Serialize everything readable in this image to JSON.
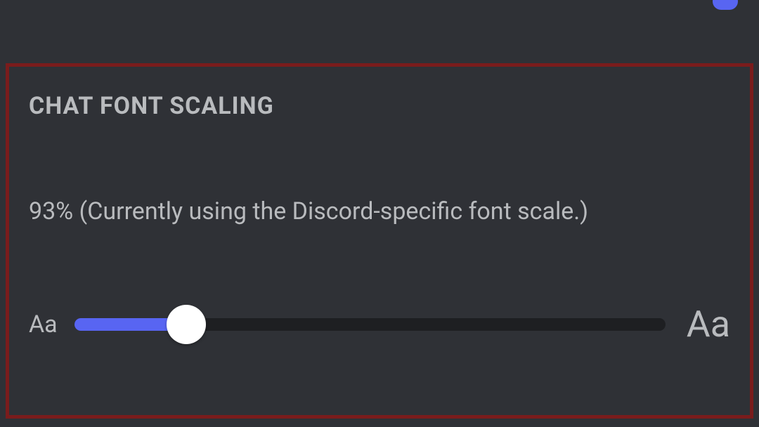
{
  "topSetting": {
    "toggleState": true
  },
  "chatFontScaling": {
    "header": "CHAT FONT SCALING",
    "description": "93% (Currently using the Discord-specific font scale.)",
    "percentValue": 93,
    "sliderPosition": 19,
    "smallLabel": "Aa",
    "largeLabel": "Aa"
  },
  "colors": {
    "accent": "#5865f2",
    "highlight": "#7a1c1c",
    "text": "#b9bbbe",
    "trackDark": "#1e1f22"
  }
}
